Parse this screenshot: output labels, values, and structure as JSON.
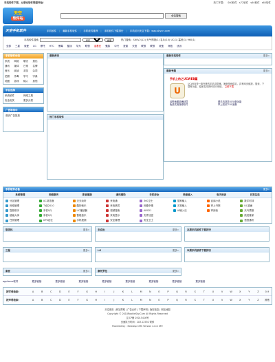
{
  "topbar": {
    "left": "手机软件下载，从哪也软件联盟开始!",
    "right_label": "热门下载：",
    "right_links": [
      "S60软件",
      "s72软件",
      "s60软件",
      "s60软件"
    ]
  },
  "header": {
    "logo_line1": "天空",
    "logo_line2": "软件站",
    "search_placeholder": "",
    "search_button": "全站搜索"
  },
  "nav": {
    "brand": "天空手机软件",
    "links": [
      "手机软件",
      "最新手机软件",
      "手机软件推荐",
      "手机软件下载排行",
      "手机访问天空下载：wap.skycn.com"
    ]
  },
  "subsearch": {
    "label": "手机软件搜索",
    "select": "所有",
    "button": "搜索",
    "hot": "热门搜索：S60V2(12) 天气预报(1) 名片(10) UC(1) 塞班(1) 960(1)"
  },
  "categories": [
    "全部",
    "三星",
    "索爱",
    "LG",
    "摩托",
    "HTC",
    "黑莓",
    "酷派",
    "华为",
    "联想",
    "诺基亚",
    "魅族",
    "中兴",
    "夏普",
    "天语",
    "联想",
    "联想",
    "琥宝",
    "海信",
    "优派"
  ],
  "left_box": {
    "title": "手机软件分类",
    "items": [
      "系统",
      "网络",
      "聊天",
      "美化",
      "通讯",
      "媒体",
      "日常",
      "名牌",
      "音乐",
      "阅读",
      "浏览",
      "杂项",
      "拍照",
      "杀毒",
      "学习",
      "字典",
      "地图",
      "游戏",
      "输入",
      "其他"
    ]
  },
  "platform_box": {
    "title": "平台选择",
    "items": [
      "系统软件",
      "网络工具",
      "安全相关",
      "更多分类"
    ]
  },
  "ad_box": {
    "title": "广告等待中",
    "text": "首页广告投放"
  },
  "mid": {
    "news_title": "最新资讯",
    "hot_title": "热门手机软件"
  },
  "right": {
    "hot_title": "最新手机软件",
    "more": "更多»",
    "pick_title": "最新专题",
    "pick_name": "手机上的之UCWEB篇",
    "pick_desc": "UCWEB是一款完美的手机浏览器，速度快而稳定，具有网页缩放、搜索、下载等功能，独家支持多种流行系统。",
    "pick_link": "立即下载",
    "links": [
      "谷歌地图精确制导",
      "看手机浏览UCW新功能",
      "免费实用保修软件",
      "掌上知识下UC最新"
    ]
  },
  "software": {
    "title": "手机软件必备",
    "more": "更多»",
    "columns": [
      {
        "head": "系统管理",
        "items": [
          "分区管理",
          "网络管理",
          "智能助手",
          "超级大师",
          "任务管理"
        ]
      },
      {
        "head": "网络聊天",
        "items": [
          "UC浏览器",
          "飞信2010",
          "手机QQ",
          "手机QQ",
          "GPS定位"
        ]
      },
      {
        "head": "影音播放",
        "items": [
          "天天动听",
          "酷狗音乐",
          "UC播放器",
          "智能音乐",
          "手机视频"
        ]
      },
      {
        "head": "通讯辅助",
        "items": [
          "来电通",
          "来电精灵",
          "视频搜索",
          "来电显示",
          "安全管理"
        ]
      },
      {
        "head": "手机安全",
        "items": [
          "360卫士",
          "网秦杀毒",
          "AR021",
          "文件加密",
          "安全卫士"
        ]
      },
      {
        "head": "快速输入",
        "items": [
          "搜狗输入",
          "五笔输入",
          "AI输入法",
          "",
          ""
        ]
      },
      {
        "head": "电子阅读",
        "items": [
          "百阅小说",
          "掌上书院",
          "掌阅读",
          "",
          ""
        ]
      },
      {
        "head": "日常生活",
        "items": [
          "数字时钟",
          "UC桌面",
          "天气预报",
          "航班管家",
          "语音通讯"
        ]
      }
    ]
  },
  "row1": {
    "b1": "联发科",
    "b2": "多说出",
    "b3": "本周手机软件下载排行",
    "more": "更多»"
  },
  "row2": {
    "b1": "三星",
    "b2": "LG",
    "b3": "本周手机软件下载排行",
    "more": "更多»"
  },
  "row3": {
    "b1": "索爱",
    "b2": "摩托罗拉",
    "more": "更多»"
  },
  "applinks": {
    "label": "appforce软件",
    "items": [
      "更多链接",
      "更多链接",
      "更多链接",
      "更多链接",
      "更多链接",
      "更多链接",
      "更多链接",
      "更多链接"
    ]
  },
  "alpha": {
    "row1_label": "按字母检索:",
    "row2_label": "按声母检索:",
    "letters": [
      "A",
      "B",
      "C",
      "D",
      "E",
      "F",
      "G",
      "H",
      "I",
      "J",
      "K",
      "L",
      "M",
      "N",
      "O",
      "P",
      "Q",
      "R",
      "S",
      "T",
      "U",
      "V",
      "W",
      "X",
      "Y",
      "Z"
    ],
    "extra": "0-9",
    "extra2": "其他"
  },
  "footer": {
    "line1": "天空首页 | 网站帮助 | 广告合作 | 下载声明 | 版权信息 | 网站地图",
    "line2": "Copyright © 2010RookieSky.Com All Rights Reserved",
    "line3": "辽ICP备 05015416号",
    "line4": "页面执行时间：203.12530 毫秒",
    "line5": "Powered by：NewAsp CMS Version 4.0.0 SP2"
  }
}
